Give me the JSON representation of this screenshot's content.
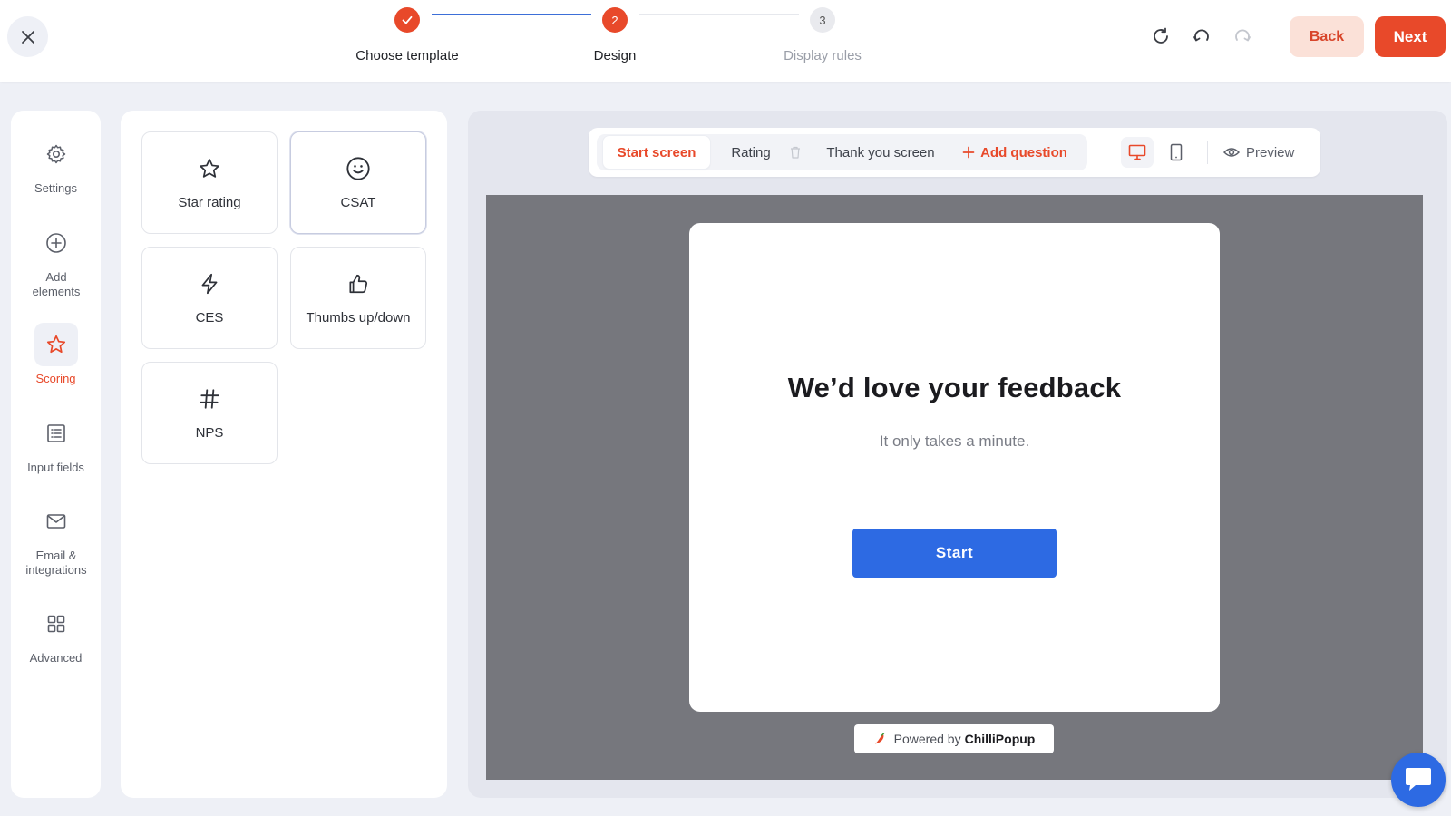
{
  "colors": {
    "accent": "#e8492a",
    "primary_button": "#2d6ae3",
    "stage_bg": "#76777d"
  },
  "header": {
    "close_icon": "close-icon",
    "steps": [
      {
        "number": "1",
        "label": "Choose template",
        "state": "done",
        "icon": "check-icon"
      },
      {
        "number": "2",
        "label": "Design",
        "state": "active"
      },
      {
        "number": "3",
        "label": "Display rules",
        "state": "pending"
      }
    ],
    "actions": {
      "refresh_icon": "refresh-icon",
      "undo_icon": "undo-icon",
      "redo_icon": "redo-icon"
    },
    "back_label": "Back",
    "next_label": "Next"
  },
  "sidebar": {
    "items": [
      {
        "label": "Settings",
        "icon": "gear-icon"
      },
      {
        "label": "Add elements",
        "icon": "plus-circle-icon"
      },
      {
        "label": "Scoring",
        "icon": "star-icon",
        "active": true
      },
      {
        "label": "Input fields",
        "icon": "list-icon"
      },
      {
        "label": "Email & integrations",
        "icon": "envelope-icon"
      },
      {
        "label": "Advanced",
        "icon": "grid-icon"
      }
    ]
  },
  "elements_panel": {
    "cards": [
      {
        "label": "Star rating",
        "icon": "star-icon"
      },
      {
        "label": "CSAT",
        "icon": "smiley-icon",
        "selected": true
      },
      {
        "label": "CES",
        "icon": "lightning-icon"
      },
      {
        "label": "Thumbs up/down",
        "icon": "thumbs-up-icon"
      },
      {
        "label": "NPS",
        "icon": "hash-icon"
      }
    ]
  },
  "toolbar": {
    "tabs": [
      {
        "label": "Start screen",
        "active": true
      },
      {
        "label": "Rating"
      },
      {
        "label": "Thank you screen"
      }
    ],
    "add_question_label": "Add question",
    "device_desktop_icon": "desktop-icon",
    "device_mobile_icon": "mobile-icon",
    "preview_label": "Preview"
  },
  "popup": {
    "title": "We’d love your feedback",
    "subtitle": "It only takes a minute.",
    "button_label": "Start"
  },
  "powered_by": {
    "prefix": "Powered by",
    "brand": "ChilliPopup"
  },
  "chat_icon": "chat-bubble-icon"
}
